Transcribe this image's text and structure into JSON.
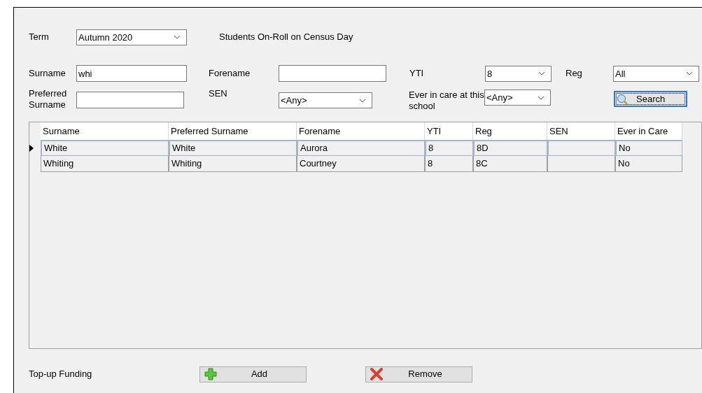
{
  "term": {
    "label": "Term",
    "value": "Autumn 2020"
  },
  "census_note": "Students On-Roll on Census Day",
  "filters": {
    "surname": {
      "label": "Surname",
      "value": "whi"
    },
    "forename": {
      "label": "Forename"
    },
    "yti": {
      "label": "YTI",
      "value": "8"
    },
    "reg": {
      "label": "Reg",
      "value": "All"
    },
    "preferred_surname": {
      "label": "Preferred Surname"
    },
    "sen": {
      "label": "SEN",
      "value": "<Any>"
    },
    "ever_in_care": {
      "label": "Ever in care at this school",
      "value": "<Any>"
    }
  },
  "search_button": "Search",
  "table": {
    "columns": [
      "Surname",
      "Preferred Surname",
      "Forename",
      "YTI",
      "Reg",
      "SEN",
      "Ever in Care"
    ],
    "rows": [
      {
        "selected": true,
        "cells": [
          "White",
          "White",
          "Aurora",
          "8",
          "8D",
          "",
          "No"
        ]
      },
      {
        "selected": false,
        "cells": [
          "Whiting",
          "Whiting",
          "Courtney",
          "8",
          "8C",
          "",
          "No"
        ]
      }
    ]
  },
  "top_up": {
    "label": "Top-up Funding",
    "buttons": [
      {
        "kind": "add",
        "label": "Add"
      },
      {
        "kind": "remove",
        "label": "Remove"
      }
    ]
  }
}
